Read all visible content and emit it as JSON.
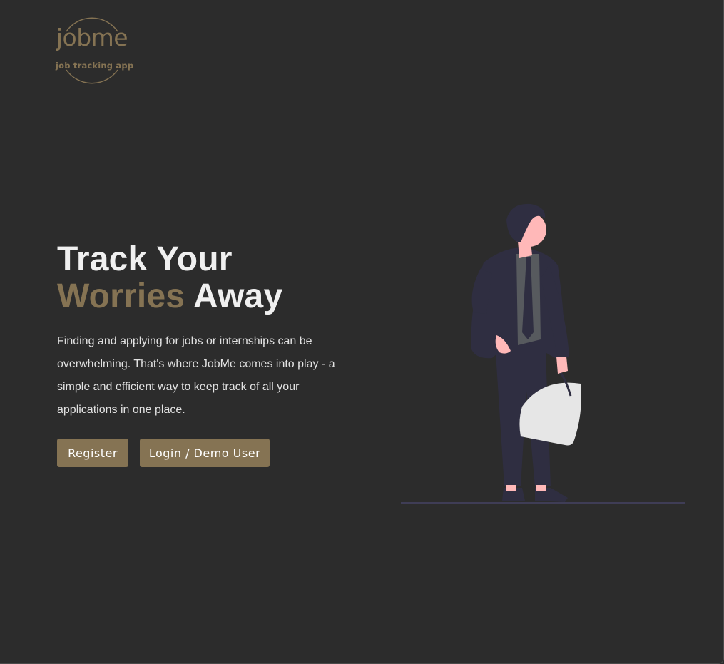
{
  "brand": {
    "name": "jobme",
    "tagline": "job tracking app",
    "accent_color": "#857353"
  },
  "hero": {
    "title_line1": "Track Your",
    "title_accent": "Worries",
    "title_rest": "Away",
    "description": "Finding and applying for jobs or internships can be overwhelming. That's where JobMe comes into play - a simple and efficient way to keep track of all your applications in one place."
  },
  "actions": {
    "register_label": "Register",
    "login_label": "Login / Demo User"
  },
  "illustration": {
    "icon": "person-with-bag-illustration"
  }
}
